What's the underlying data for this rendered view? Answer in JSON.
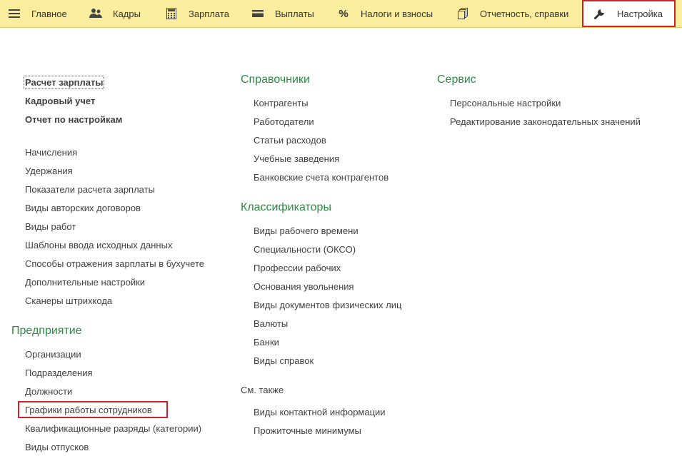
{
  "nav": {
    "tabs": [
      {
        "label": "Главное",
        "icon": "menu-icon"
      },
      {
        "label": "Кадры",
        "icon": "people-icon"
      },
      {
        "label": "Зарплата",
        "icon": "calculator-icon"
      },
      {
        "label": "Выплаты",
        "icon": "wallet-icon"
      },
      {
        "label": "Налоги и взносы",
        "icon": "percent-icon"
      },
      {
        "label": "Отчетность, справки",
        "icon": "documents-icon"
      },
      {
        "label": "Настройка",
        "icon": "wrench-icon",
        "active": true
      }
    ]
  },
  "col1": {
    "top_links": [
      "Расчет зарплаты",
      "Кадровый учет",
      "Отчет по настройкам"
    ],
    "links": [
      "Начисления",
      "Удержания",
      "Показатели расчета зарплаты",
      "Виды авторских договоров",
      "Виды работ",
      "Шаблоны ввода исходных данных",
      "Способы отражения зарплаты в бухучете",
      "Дополнительные настройки",
      "Сканеры штрихкода"
    ],
    "section_title": "Предприятие",
    "section_links": [
      "Организации",
      "Подразделения",
      "Должности",
      "Графики работы сотрудников",
      "Квалификационные разряды (категории)",
      "Виды отпусков"
    ]
  },
  "col2": {
    "ref_title": "Справочники",
    "ref_links": [
      "Контрагенты",
      "Работодатели",
      "Статьи расходов",
      "Учебные заведения",
      "Банковские счета контрагентов"
    ],
    "cls_title": "Классификаторы",
    "cls_links": [
      "Виды рабочего времени",
      "Специальности (ОКСО)",
      "Профессии рабочих",
      "Основания увольнения",
      "Виды документов физических лиц",
      "Валюты",
      "Банки",
      "Виды справок"
    ],
    "see_also_title": "См. также",
    "see_also_links": [
      "Виды контактной информации",
      "Прожиточные минимумы"
    ]
  },
  "col3": {
    "title": "Сервис",
    "links": [
      "Персональные настройки",
      "Редактирование законодательных значений"
    ]
  },
  "colors": {
    "topbar": "#fbed9e",
    "section": "#2c8a45",
    "highlight": "#d0202a"
  }
}
